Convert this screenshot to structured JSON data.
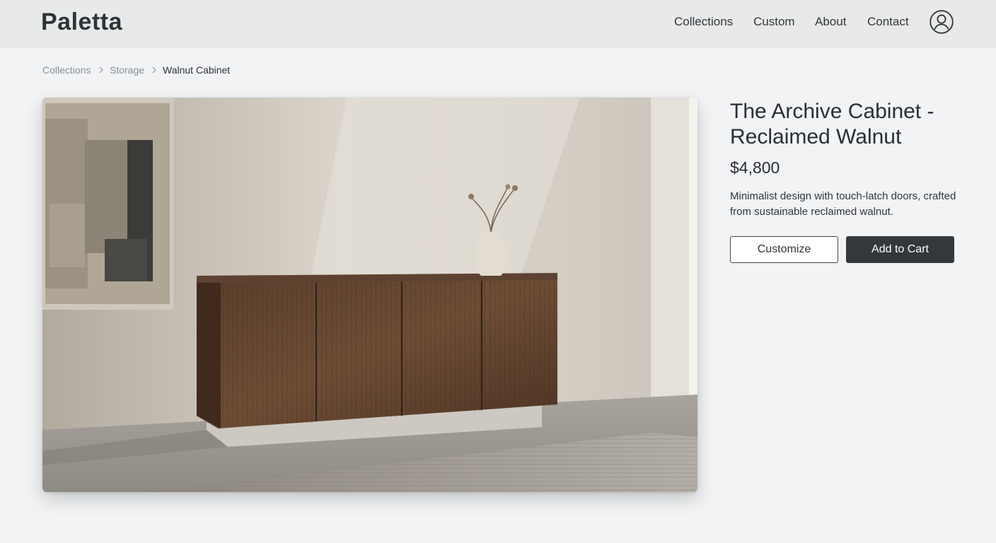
{
  "header": {
    "logo": "Paletta",
    "nav": [
      {
        "label": "Collections"
      },
      {
        "label": "Custom"
      },
      {
        "label": "About"
      },
      {
        "label": "Contact"
      }
    ],
    "profile_icon": "user-circle-icon"
  },
  "breadcrumb": {
    "items": [
      {
        "label": "Collections"
      },
      {
        "label": "Storage"
      },
      {
        "label": "Walnut Cabinet"
      }
    ],
    "separator_icon": "chevron-right-icon"
  },
  "product": {
    "title": "The Archive Cabinet - Reclaimed Walnut",
    "price": "$4,800",
    "description": "Minimalist design with touch-latch doors, crafted from sustainable reclaimed walnut.",
    "customize_label": "Customize",
    "add_to_cart_label": "Add to Cart"
  },
  "colors": {
    "background": "#f1f3f5",
    "header": "#e8e9e9",
    "primary_button": "#34373c",
    "text": "#2b2e33",
    "muted_text": "#8a8e93"
  }
}
